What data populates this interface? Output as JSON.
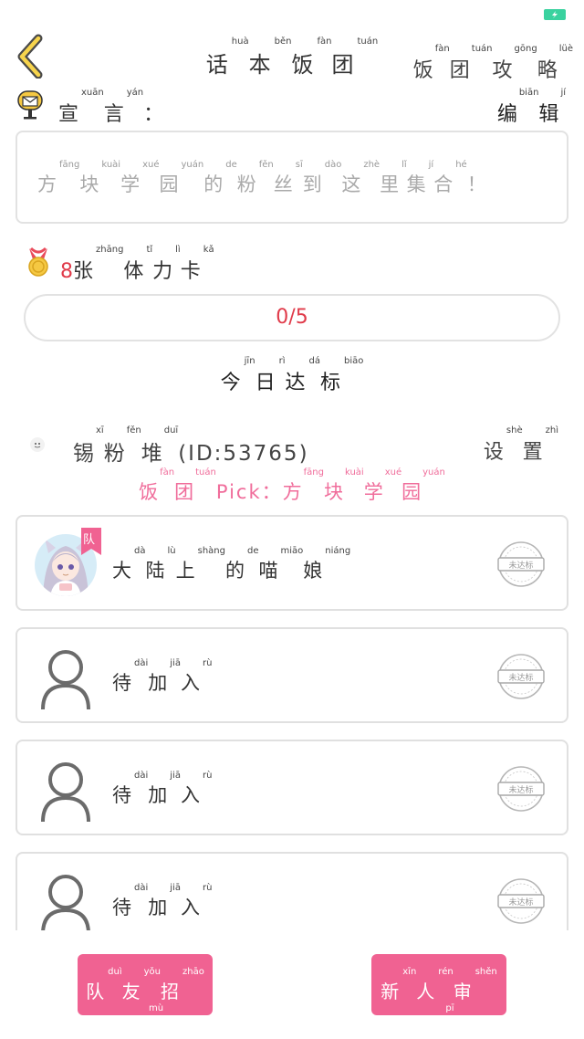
{
  "status_bar": {
    "battery_color": "#3ad29f"
  },
  "header": {
    "title": [
      {
        "char": "话",
        "py": "huà"
      },
      {
        "char": "本",
        "py": "běn"
      },
      {
        "char": "饭",
        "py": "fàn"
      },
      {
        "char": "团",
        "py": "tuán"
      }
    ],
    "guide_link": [
      {
        "char": "饭",
        "py": "fàn"
      },
      {
        "char": "团",
        "py": "tuán"
      },
      {
        "char": "攻",
        "py": "gōng"
      },
      {
        "char": "略",
        "py": "lüè"
      }
    ],
    "back_icon": "chevron-left-icon"
  },
  "declaration": {
    "label": [
      {
        "char": "宣",
        "py": "xuān"
      },
      {
        "char": "言",
        "py": "yán"
      },
      {
        "char": "：",
        "py": ""
      }
    ],
    "edit_label": [
      {
        "char": "编",
        "py": "biān"
      },
      {
        "char": "辑",
        "py": "jí"
      }
    ],
    "text": [
      {
        "char": "方",
        "py": "fāng"
      },
      {
        "char": "块",
        "py": "kuài"
      },
      {
        "char": "学",
        "py": "xué"
      },
      {
        "char": "园",
        "py": "yuán"
      },
      {
        "char": "的",
        "py": "de"
      },
      {
        "char": "粉",
        "py": "fěn"
      },
      {
        "char": "丝",
        "py": "sī"
      },
      {
        "char": "到",
        "py": "dào"
      },
      {
        "char": "这",
        "py": "zhè"
      },
      {
        "char": "里",
        "py": "lǐ"
      },
      {
        "char": "集",
        "py": "jí"
      },
      {
        "char": "合",
        "py": "hé"
      },
      {
        "char": "！",
        "py": ""
      }
    ]
  },
  "cards": {
    "count": "8",
    "label": [
      {
        "char": "张",
        "py": "zhāng"
      },
      {
        "char": "体",
        "py": "tǐ"
      },
      {
        "char": "力",
        "py": "lì"
      },
      {
        "char": "卡",
        "py": "kǎ"
      }
    ]
  },
  "progress": {
    "text": "0/5",
    "fraction": 0
  },
  "today": {
    "label": [
      {
        "char": "今",
        "py": "jīn"
      },
      {
        "char": "日",
        "py": "rì"
      },
      {
        "char": "达",
        "py": "dá"
      },
      {
        "char": "标",
        "py": "biāo"
      }
    ]
  },
  "group": {
    "name": [
      {
        "char": "锡",
        "py": "xī"
      },
      {
        "char": "粉",
        "py": "fěn"
      },
      {
        "char": "堆",
        "py": "duī"
      }
    ],
    "id_text": "(ID:53765)",
    "settings_label": [
      {
        "char": "设",
        "py": "shè"
      },
      {
        "char": "置",
        "py": "zhì"
      }
    ],
    "pick_prefix": [
      {
        "char": "饭",
        "py": "fàn"
      },
      {
        "char": "团",
        "py": "tuán"
      }
    ],
    "pick_word": "Pick：",
    "pick_value": [
      {
        "char": "方",
        "py": "fāng"
      },
      {
        "char": "块",
        "py": "kuài"
      },
      {
        "char": "学",
        "py": "xué"
      },
      {
        "char": "园",
        "py": "yuán"
      }
    ]
  },
  "members": [
    {
      "type": "leader",
      "badge": "队",
      "stamp": "未达标",
      "name": [
        {
          "char": "大",
          "py": "dà"
        },
        {
          "char": "陆",
          "py": "lù"
        },
        {
          "char": "上",
          "py": "shàng"
        },
        {
          "char": "的",
          "py": "de"
        },
        {
          "char": "喵",
          "py": "miāo"
        },
        {
          "char": "娘",
          "py": "niáng"
        }
      ]
    },
    {
      "type": "empty",
      "stamp": "未达标",
      "name": [
        {
          "char": "待",
          "py": "dài"
        },
        {
          "char": "加",
          "py": "jiā"
        },
        {
          "char": "入",
          "py": "rù"
        }
      ]
    },
    {
      "type": "empty",
      "stamp": "未达标",
      "name": [
        {
          "char": "待",
          "py": "dài"
        },
        {
          "char": "加",
          "py": "jiā"
        },
        {
          "char": "入",
          "py": "rù"
        }
      ]
    },
    {
      "type": "empty",
      "stamp": "未达标",
      "name": [
        {
          "char": "待",
          "py": "dài"
        },
        {
          "char": "加",
          "py": "jiā"
        },
        {
          "char": "入",
          "py": "rù"
        }
      ]
    }
  ],
  "buttons": {
    "recruit": [
      {
        "char": "队",
        "py": "duì"
      },
      {
        "char": "友",
        "py": "yǒu"
      },
      {
        "char": "招",
        "py": "zhāo"
      },
      {
        "char": "募",
        "py": "mù"
      }
    ],
    "approve": [
      {
        "char": "新",
        "py": "xīn"
      },
      {
        "char": "人",
        "py": "rén"
      },
      {
        "char": "审",
        "py": "shěn"
      },
      {
        "char": "批",
        "py": "pī"
      }
    ]
  },
  "colors": {
    "accent_pink": "#f06292",
    "pick_pink": "#f06d9b",
    "alert_red": "#e03b4a",
    "border_gray": "#e0e0e0"
  }
}
